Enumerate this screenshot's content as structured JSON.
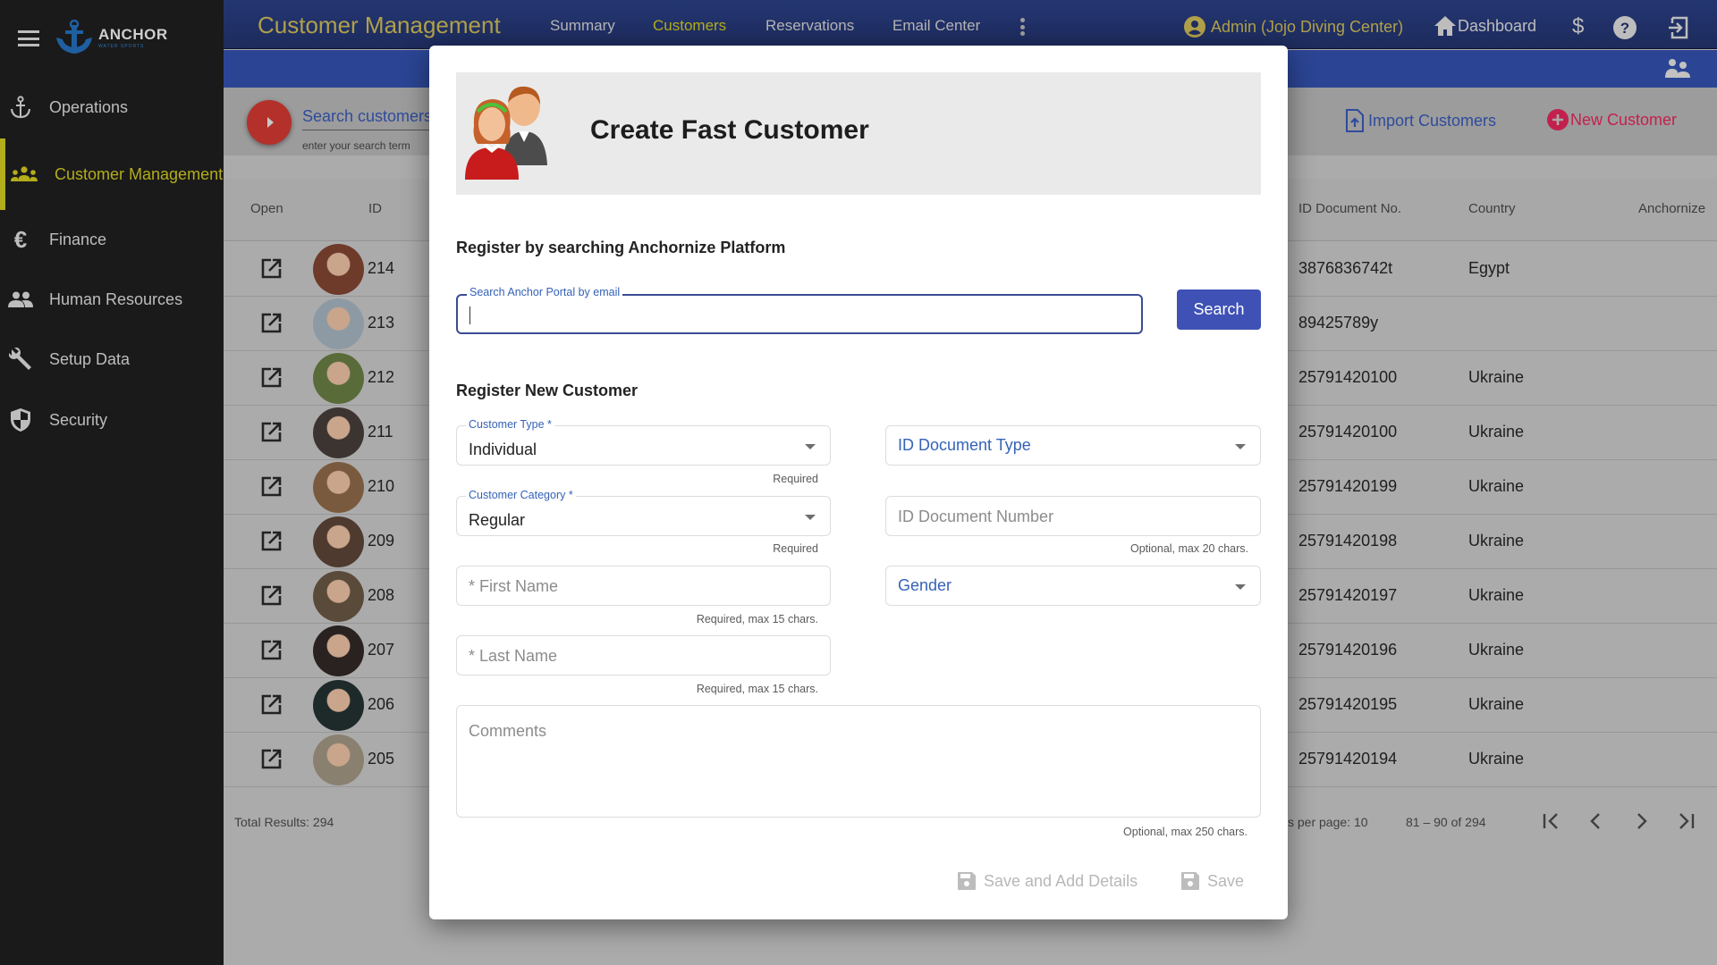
{
  "sidebar": {
    "logo_text": "ANCHOR",
    "logo_sub": "WATER SPORTS",
    "items": [
      {
        "label": "Operations",
        "icon": "anchor-icon"
      },
      {
        "label": "Customer Management",
        "icon": "groups-icon",
        "active": true
      },
      {
        "label": "Finance",
        "icon": "euro-icon"
      },
      {
        "label": "Human Resources",
        "icon": "people-icon"
      },
      {
        "label": "Setup Data",
        "icon": "wrench-icon"
      },
      {
        "label": "Security",
        "icon": "shield-icon"
      }
    ]
  },
  "topbar": {
    "title": "Customer Management",
    "tabs": [
      "Summary",
      "Customers",
      "Reservations",
      "Email Center"
    ],
    "active_tab": "Customers",
    "user": "Admin (Jojo Diving Center)",
    "dashboard": "Dashboard"
  },
  "toolbar": {
    "search_label": "Search customers",
    "search_hint": "enter your search term",
    "import_label": "Import Customers",
    "new_label": "New Customer"
  },
  "table": {
    "headers": {
      "open": "Open",
      "id": "ID",
      "doc": "ID Document No.",
      "country": "Country",
      "anchornize": "Anchornize"
    },
    "rows": [
      {
        "id": "214",
        "doc": "3876836742t",
        "country": "Egypt"
      },
      {
        "id": "213",
        "doc": "89425789y",
        "country": ""
      },
      {
        "id": "212",
        "doc": "25791420100",
        "country": "Ukraine"
      },
      {
        "id": "211",
        "doc": "25791420100",
        "country": "Ukraine"
      },
      {
        "id": "210",
        "doc": "25791420199",
        "country": "Ukraine"
      },
      {
        "id": "209",
        "doc": "25791420198",
        "country": "Ukraine"
      },
      {
        "id": "208",
        "doc": "25791420197",
        "country": "Ukraine"
      },
      {
        "id": "207",
        "doc": "25791420196",
        "country": "Ukraine"
      },
      {
        "id": "206",
        "doc": "25791420195",
        "country": "Ukraine"
      },
      {
        "id": "205",
        "doc": "25791420194",
        "country": "Ukraine"
      }
    ],
    "total": "Total Results: 294",
    "per_page": "s per page: 10",
    "range": "81 – 90 of 294"
  },
  "modal": {
    "title": "Create Fast Customer",
    "section1": "Register by searching Anchornize Platform",
    "search_label": "Search Anchor Portal by email",
    "search_value": "",
    "search_button": "Search",
    "section2": "Register New Customer",
    "customer_type": {
      "label": "Customer Type *",
      "value": "Individual",
      "hint": "Required"
    },
    "customer_category": {
      "label": "Customer Category *",
      "value": "Regular",
      "hint": "Required"
    },
    "first_name": {
      "placeholder": "* First Name",
      "hint": "Required, max 15 chars."
    },
    "last_name": {
      "placeholder": "* Last Name",
      "hint": "Required, max 15 chars."
    },
    "id_doc_type": {
      "placeholder": "ID Document Type"
    },
    "id_doc_number": {
      "placeholder": "ID Document Number",
      "hint": "Optional, max 20 chars."
    },
    "gender": {
      "placeholder": "Gender"
    },
    "comments": {
      "placeholder": "Comments",
      "hint": "Optional, max 250 chars."
    },
    "save_add_label": "Save and Add Details",
    "save_label": "Save"
  }
}
